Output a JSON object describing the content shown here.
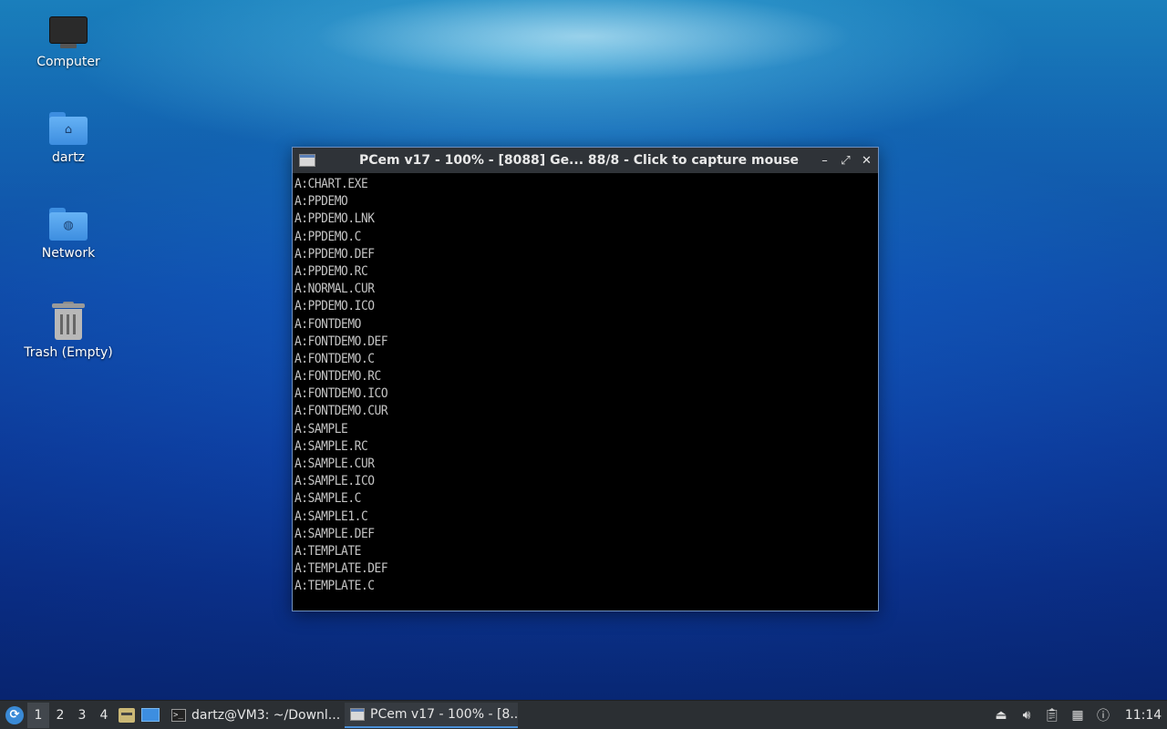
{
  "desktop": {
    "icons": [
      {
        "label": "Computer"
      },
      {
        "label": "dartz"
      },
      {
        "label": "Network"
      },
      {
        "label": "Trash (Empty)"
      }
    ]
  },
  "window": {
    "title": "PCem v17 - 100% - [8088] Ge... 88/8 - Click to capture mouse",
    "lines": [
      "A:CHART.EXE",
      "A:PPDEMO",
      "A:PPDEMO.LNK",
      "A:PPDEMO.C",
      "A:PPDEMO.DEF",
      "A:PPDEMO.RC",
      "A:NORMAL.CUR",
      "A:PPDEMO.ICO",
      "A:FONTDEMO",
      "A:FONTDEMO.DEF",
      "A:FONTDEMO.C",
      "A:FONTDEMO.RC",
      "A:FONTDEMO.ICO",
      "A:FONTDEMO.CUR",
      "A:SAMPLE",
      "A:SAMPLE.RC",
      "A:SAMPLE.CUR",
      "A:SAMPLE.ICO",
      "A:SAMPLE.C",
      "A:SAMPLE1.C",
      "A:SAMPLE.DEF",
      "A:TEMPLATE",
      "A:TEMPLATE.DEF",
      "A:TEMPLATE.C"
    ]
  },
  "taskbar": {
    "workspaces": [
      "1",
      "2",
      "3",
      "4"
    ],
    "active_workspace": "1",
    "tasks": [
      {
        "label": "dartz@VM3: ~/Downl...",
        "icon": "terminal-icon"
      },
      {
        "label": "PCem v17 - 100% - [8...",
        "icon": "window-icon"
      }
    ],
    "clock": "11:14"
  }
}
